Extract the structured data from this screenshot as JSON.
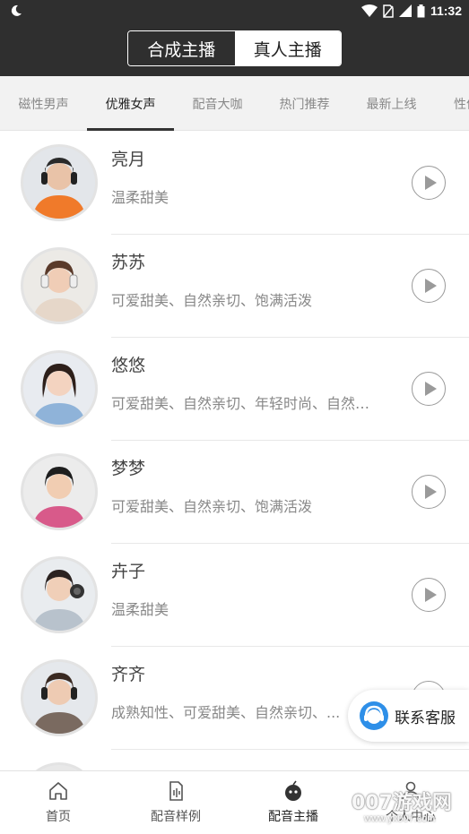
{
  "status_bar": {
    "time": "11:32",
    "icons": [
      "moon-icon",
      "wifi-icon",
      "no-sim-icon",
      "signal-icon",
      "battery-icon"
    ]
  },
  "header": {
    "segments": [
      {
        "label": "合成主播",
        "active": false
      },
      {
        "label": "真人主播",
        "active": true
      }
    ]
  },
  "category_tabs": [
    {
      "label": "磁性男声",
      "active": false
    },
    {
      "label": "优雅女声",
      "active": true
    },
    {
      "label": "配音大咖",
      "active": false
    },
    {
      "label": "热门推荐",
      "active": false
    },
    {
      "label": "最新上线",
      "active": false
    },
    {
      "label": "性价",
      "active": false
    }
  ],
  "anchors": [
    {
      "name": "亮月",
      "tags": "温柔甜美",
      "avatar_color": "#f07a2a"
    },
    {
      "name": "苏苏",
      "tags": "可爱甜美、自然亲切、饱满活泼",
      "avatar_color": "#e6d7c9"
    },
    {
      "name": "悠悠",
      "tags": "可爱甜美、自然亲切、年轻时尚、自然…",
      "avatar_color": "#8fb3d9"
    },
    {
      "name": "梦梦",
      "tags": "可爱甜美、自然亲切、饱满活泼",
      "avatar_color": "#d85a8a"
    },
    {
      "name": "卉子",
      "tags": "温柔甜美",
      "avatar_color": "#b8c2cc"
    },
    {
      "name": "齐齐",
      "tags": "成熟知性、可爱甜美、自然亲切、...",
      "avatar_color": "#7a6a60"
    },
    {
      "name": "",
      "tags": "",
      "avatar_color": "#cccccc"
    }
  ],
  "service": {
    "label": "联系客服"
  },
  "bottom_nav": [
    {
      "label": "首页",
      "icon": "home-icon",
      "active": false
    },
    {
      "label": "配音样例",
      "icon": "audio-file-icon",
      "active": false
    },
    {
      "label": "配音主播",
      "icon": "robot-icon",
      "active": true
    },
    {
      "label": "个人中心",
      "icon": "person-icon",
      "active": false
    }
  ],
  "watermark": {
    "big": "007游戏网",
    "small": "www.yx007.com"
  }
}
